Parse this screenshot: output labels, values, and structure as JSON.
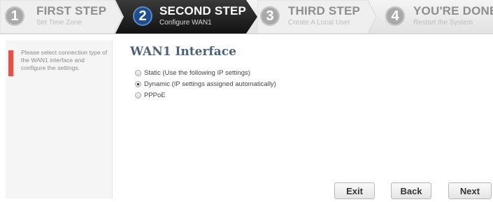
{
  "wizard": {
    "steps": [
      {
        "number": "1",
        "title": "FIRST STEP",
        "subtitle": "Set Time Zone",
        "state": "inactive"
      },
      {
        "number": "2",
        "title": "SECOND STEP",
        "subtitle": "Configure WAN1",
        "state": "active"
      },
      {
        "number": "3",
        "title": "THIRD STEP",
        "subtitle": "Create A Local User",
        "state": "inactive"
      },
      {
        "number": "4",
        "title": "YOU'RE DONE",
        "subtitle": "Restart the System",
        "state": "inactive"
      }
    ],
    "colors": {
      "active_step": "#1c1c1c",
      "active_number": "#1f4e8f",
      "inactive_number": "#a9a9a9",
      "sidebar_accent": "#e0534a",
      "title": "#4f6077"
    }
  },
  "sidebar": {
    "hint": "Please select connection type of the WAN1 interface and configure the settings."
  },
  "main": {
    "title": "WAN1 Interface",
    "options": [
      {
        "label": "Static (Use the following IP settings)",
        "checked": false
      },
      {
        "label": "Dynamic (IP settings assigned automatically)",
        "checked": true
      },
      {
        "label": "PPPoE",
        "checked": false
      }
    ]
  },
  "buttons": {
    "exit": "Exit",
    "back": "Back",
    "next": "Next"
  }
}
